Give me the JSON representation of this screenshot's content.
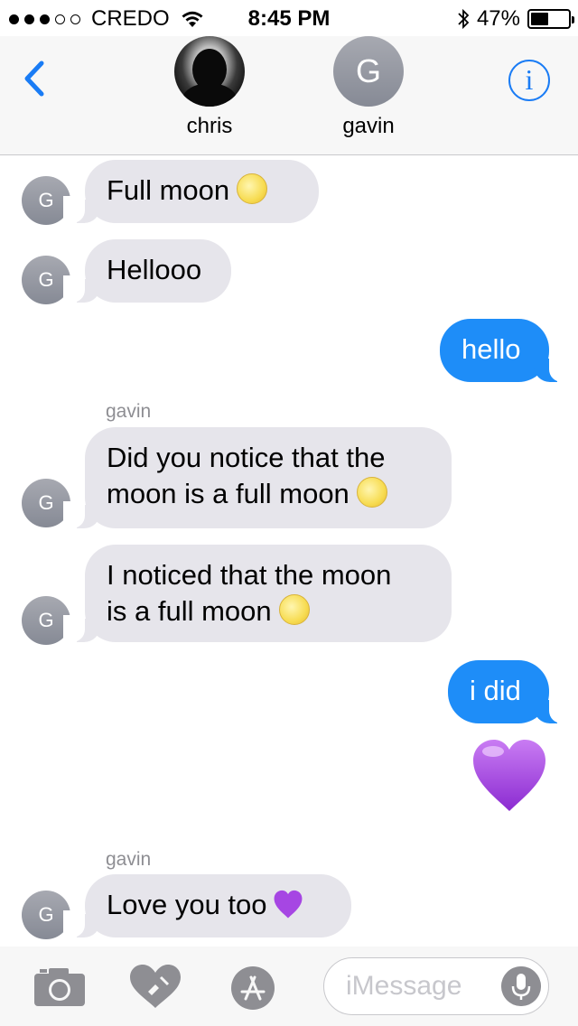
{
  "status_bar": {
    "carrier": "CREDO",
    "time": "8:45 PM",
    "battery": "47%",
    "battery_level": 0.47,
    "signal_bars": 3,
    "signal_total": 5
  },
  "header": {
    "participants": [
      {
        "name": "chris",
        "avatar": "photo"
      },
      {
        "name": "gavin",
        "avatar_letter": "G"
      }
    ],
    "back_icon": "chevron-left-icon",
    "info_icon": "info-icon",
    "info_label": "i"
  },
  "messages": [
    {
      "direction": "incoming",
      "avatar": "G",
      "text": "Full moon",
      "emoji": "full-moon"
    },
    {
      "direction": "incoming",
      "avatar": "G",
      "text": "Hellooo"
    },
    {
      "direction": "outgoing",
      "text": "hello"
    },
    {
      "direction": "incoming",
      "sender": "gavin",
      "avatar": "G",
      "lines": [
        "Did you notice that the",
        "moon is a full moon"
      ],
      "emoji": "full-moon"
    },
    {
      "direction": "incoming",
      "avatar": "G",
      "lines": [
        "I noticed that the moon",
        "is a full moon"
      ],
      "emoji": "full-moon"
    },
    {
      "direction": "outgoing",
      "text": "i did"
    },
    {
      "direction": "outgoing",
      "emoji_only": "purple-heart"
    },
    {
      "direction": "incoming",
      "sender": "gavin",
      "avatar": "G",
      "text": "Love you too",
      "emoji": "purple-heart"
    }
  ],
  "input_bar": {
    "placeholder": "iMessage",
    "icons": [
      "camera-icon",
      "digital-touch-heart-icon",
      "app-store-icon",
      "microphone-icon"
    ]
  },
  "colors": {
    "accent": "#1a7cf5",
    "outgoing_bubble": "#1e8df8",
    "incoming_bubble": "#e6e5eb",
    "avatar_gray": "#8e8e93"
  }
}
